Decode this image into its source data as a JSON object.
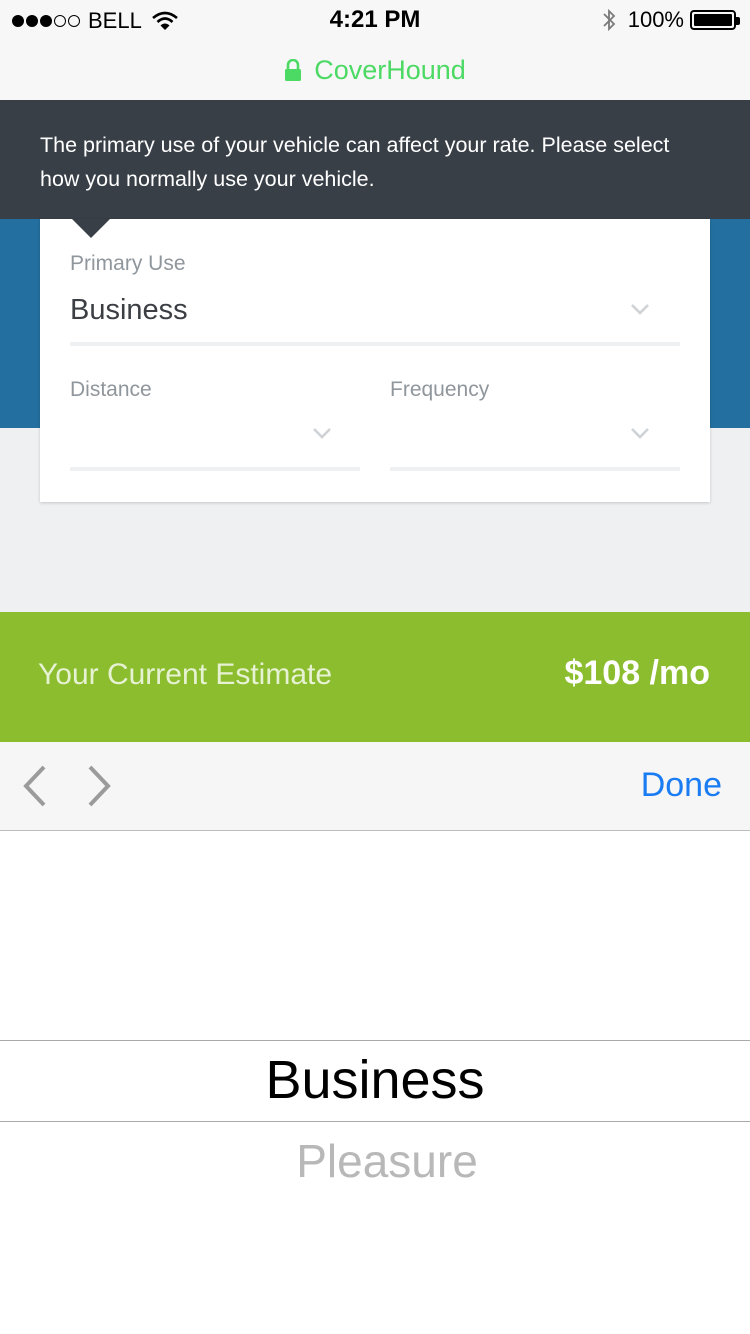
{
  "status_bar": {
    "carrier": "BELL",
    "time": "4:21 PM",
    "battery": "100%",
    "signal_strength": 3
  },
  "url_bar": {
    "site": "CoverHound"
  },
  "tooltip": {
    "text": "The primary use of your vehicle can affect your rate. Please select how you normally use your vehicle."
  },
  "form": {
    "primary_use": {
      "label": "Primary Use",
      "value": "Business"
    },
    "distance": {
      "label": "Distance",
      "value": ""
    },
    "frequency": {
      "label": "Frequency",
      "value": ""
    }
  },
  "estimate": {
    "label": "Your Current Estimate",
    "value": "$108 /mo"
  },
  "accessory": {
    "done_label": "Done"
  },
  "picker": {
    "selected": "Business",
    "options": [
      "Business",
      "Pleasure"
    ]
  },
  "colors": {
    "accent_green": "#8bbd2f",
    "header_blue": "#236f9f",
    "tooltip_dark": "#383f47",
    "link_blue": "#1a7cf2",
    "secure_green": "#4cd964"
  }
}
